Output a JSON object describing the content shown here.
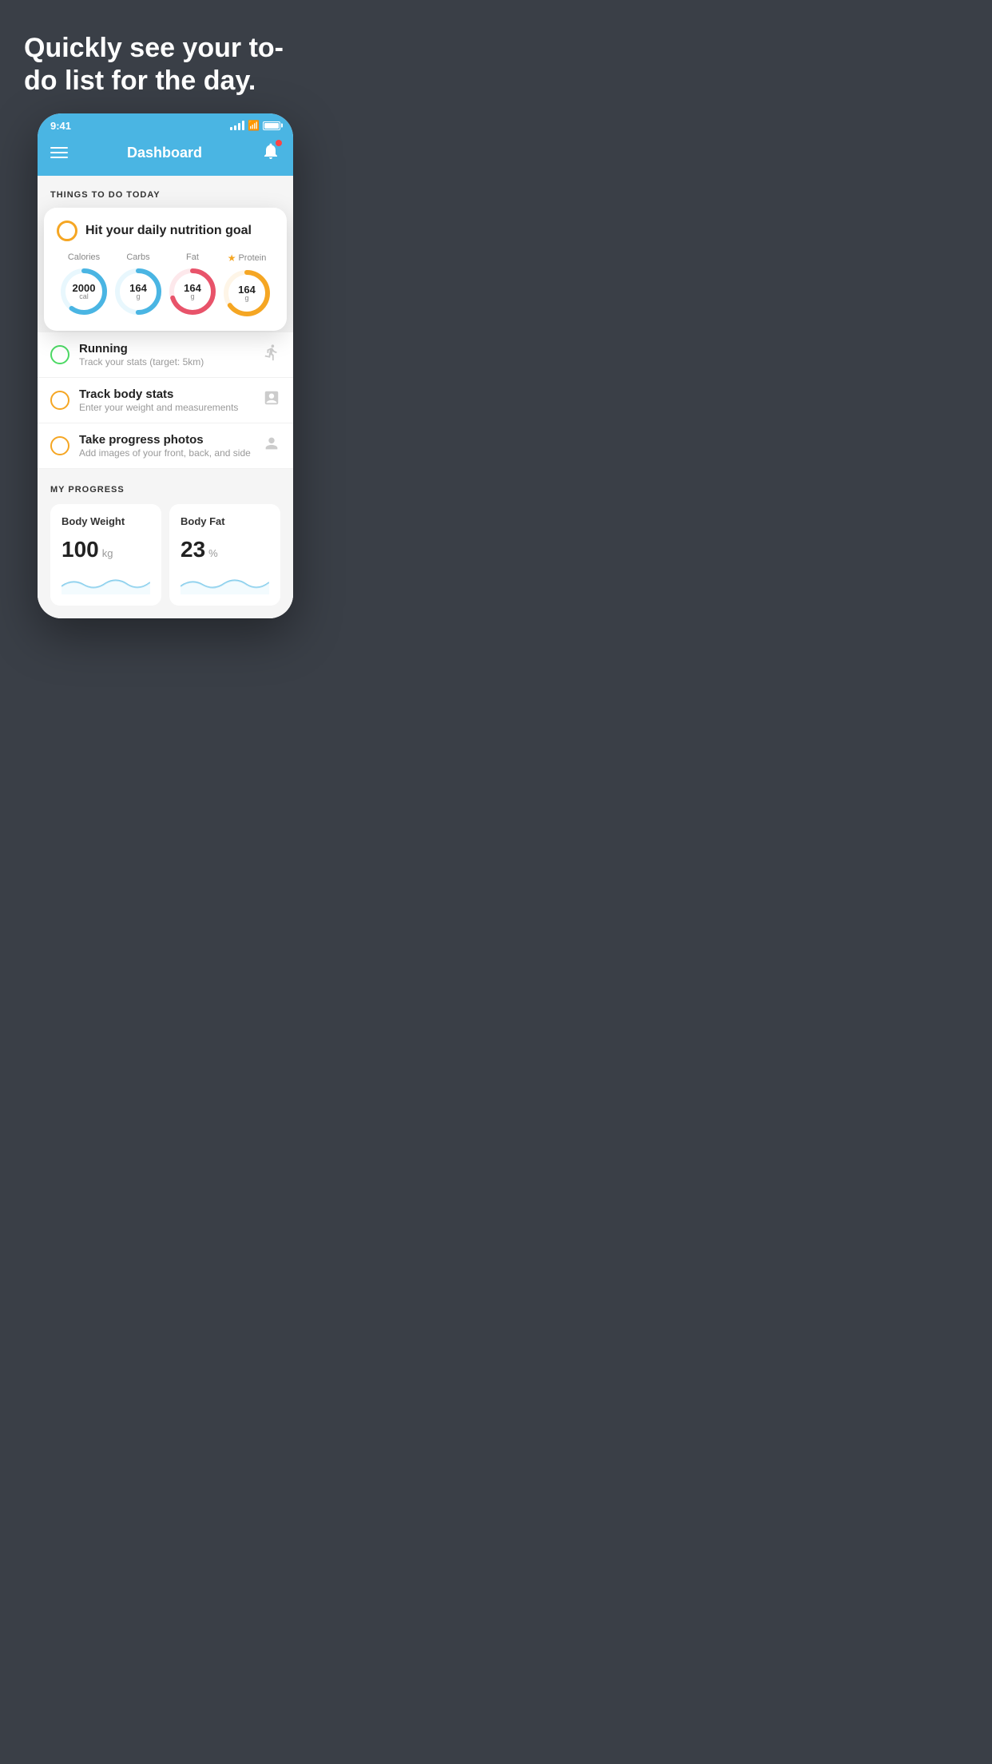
{
  "hero": {
    "title": "Quickly see your to-do list for the day."
  },
  "phone": {
    "status_bar": {
      "time": "9:41"
    },
    "header": {
      "title": "Dashboard"
    },
    "things_section": {
      "title": "THINGS TO DO TODAY"
    },
    "nutrition_card": {
      "checkbox_status": "empty",
      "title": "Hit your daily nutrition goal",
      "items": [
        {
          "label": "Calories",
          "value": "2000",
          "unit": "cal",
          "color": "#4ab5e3",
          "track_color": "#e8f7fd",
          "progress": 60,
          "starred": false
        },
        {
          "label": "Carbs",
          "value": "164",
          "unit": "g",
          "color": "#4ab5e3",
          "track_color": "#e8f7fd",
          "progress": 50,
          "starred": false
        },
        {
          "label": "Fat",
          "value": "164",
          "unit": "g",
          "color": "#e8536a",
          "track_color": "#fde8eb",
          "progress": 70,
          "starred": false
        },
        {
          "label": "Protein",
          "value": "164",
          "unit": "g",
          "color": "#f5a623",
          "track_color": "#fef5e7",
          "progress": 65,
          "starred": true
        }
      ]
    },
    "todo_items": [
      {
        "id": "running",
        "title": "Running",
        "subtitle": "Track your stats (target: 5km)",
        "circle_color": "green",
        "icon": "shoe"
      },
      {
        "id": "body-stats",
        "title": "Track body stats",
        "subtitle": "Enter your weight and measurements",
        "circle_color": "yellow",
        "icon": "scale"
      },
      {
        "id": "progress-photos",
        "title": "Take progress photos",
        "subtitle": "Add images of your front, back, and side",
        "circle_color": "yellow",
        "icon": "person"
      }
    ],
    "progress_section": {
      "title": "MY PROGRESS",
      "cards": [
        {
          "id": "body-weight",
          "title": "Body Weight",
          "value": "100",
          "unit": "kg"
        },
        {
          "id": "body-fat",
          "title": "Body Fat",
          "value": "23",
          "unit": "%"
        }
      ]
    }
  }
}
